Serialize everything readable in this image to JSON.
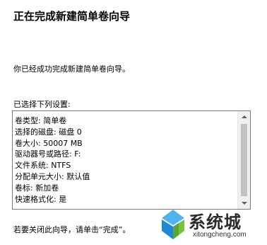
{
  "wizard": {
    "title": "正在完成新建简单卷向导",
    "intro": "你已经成功完成新建简单卷向导。",
    "settings_label": "已选择下列设置:",
    "settings": [
      "卷类型: 简单卷",
      "选择的磁盘: 磁盘 0",
      "卷大小: 50007 MB",
      "驱动器号或路径: F:",
      "文件系统: NTFS",
      "分配单元大小: 默认值",
      "卷标: 新加卷",
      "快速格式化: 是"
    ],
    "footer": "若要关闭此向导，请单击“完成”。"
  },
  "watermark": {
    "name": "系统城",
    "url": "xitongcheng.com",
    "colors": {
      "blue": "#1e88d8",
      "light_blue": "#4fb3f0",
      "green": "#7ac143",
      "text": "#2b2b2b"
    }
  }
}
